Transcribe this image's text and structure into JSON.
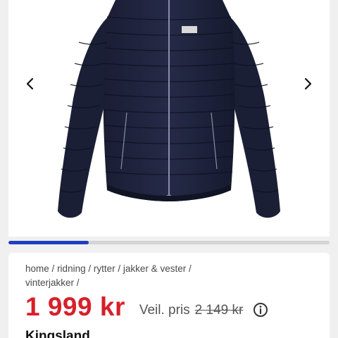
{
  "gallery": {
    "image_alt": "Navy quilted jacket",
    "prev_icon": "chevron-left-icon",
    "next_icon": "chevron-right-icon",
    "progress": 0.25,
    "accent_color": "#1f3fbf"
  },
  "breadcrumb": {
    "items": [
      "home",
      "ridning",
      "rytter",
      "jakker & vester",
      "vinterjakker"
    ],
    "separator": "/"
  },
  "price": {
    "current": "1 999 kr",
    "reference_label": "Veil. pris",
    "reference": "2 149 kr",
    "info_icon": "info-circle-icon",
    "price_color": "#d7202a"
  },
  "product": {
    "brand": "Kingsland"
  }
}
